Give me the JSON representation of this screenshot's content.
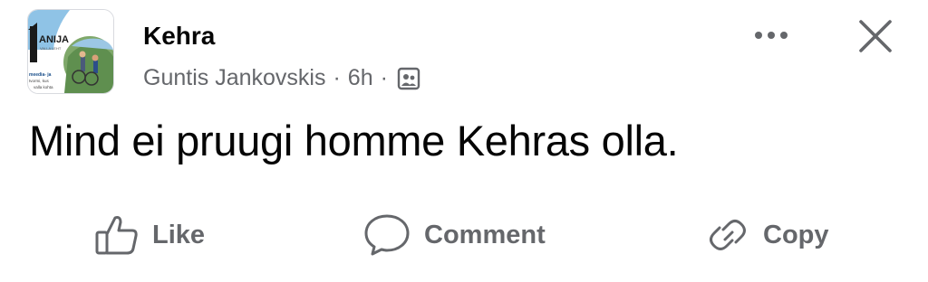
{
  "post": {
    "group_name": "Kehra",
    "author": "Guntis Jankovskis",
    "separator": "·",
    "time": "6h",
    "audience_icon": "members-icon",
    "text": "Mind ei pruugi homme Kehras olla."
  },
  "header_actions": {
    "more_icon": "more-horizontal-icon",
    "close_icon": "close-icon"
  },
  "avatar": {
    "logo_text": "ANIJA",
    "sub_text": "VALLA LEHT",
    "line1": "meedia- ja",
    "line2": "tvormi, kus",
    "line3": "valla kohta"
  },
  "actions": {
    "like_label": "Like",
    "comment_label": "Comment",
    "copy_label": "Copy"
  },
  "colors": {
    "text_primary": "#050505",
    "text_secondary": "#65676b",
    "background": "#ffffff"
  }
}
